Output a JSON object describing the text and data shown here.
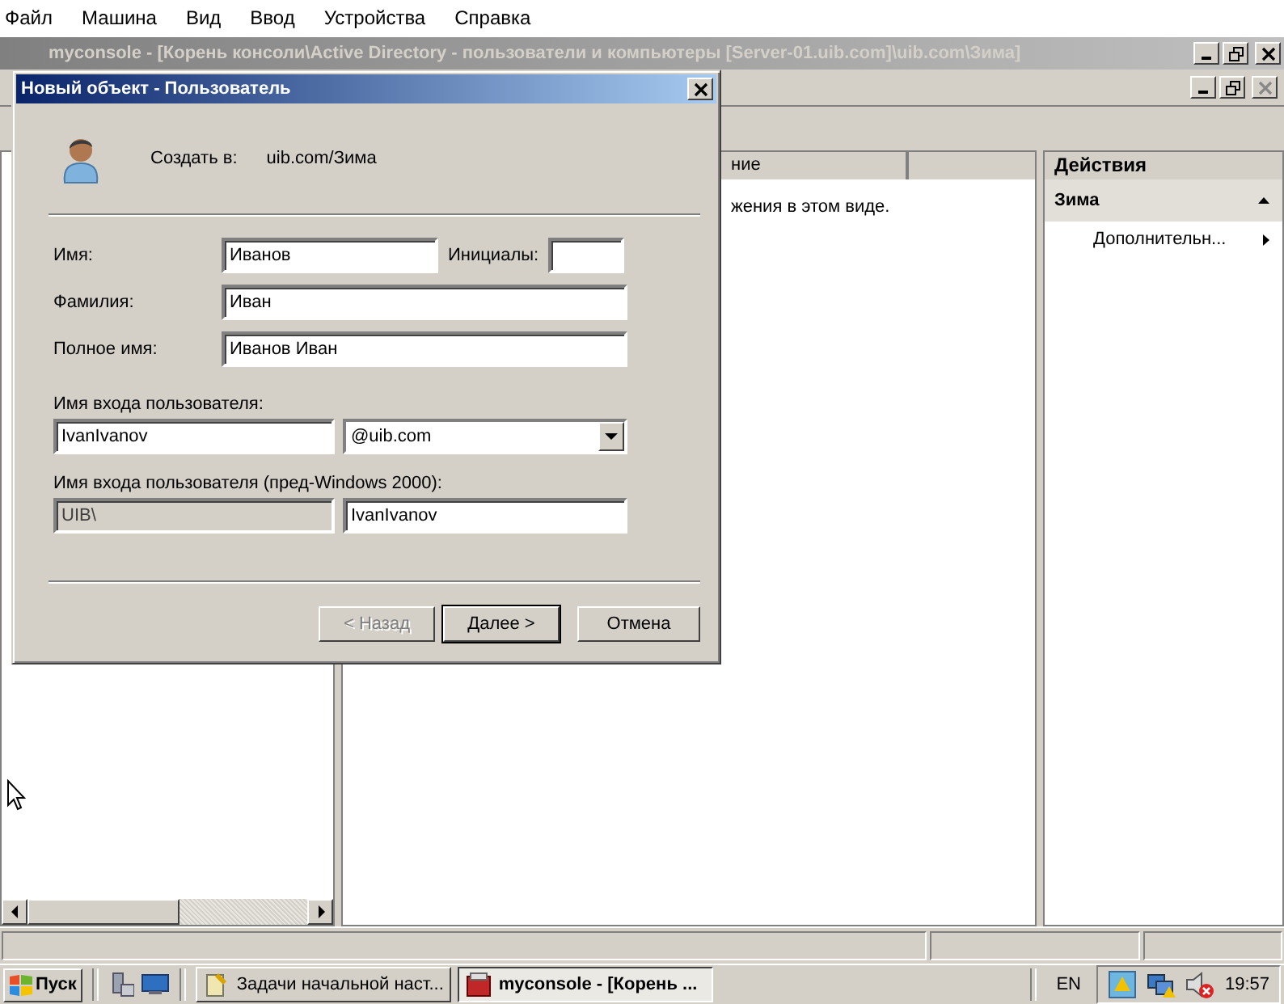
{
  "host_menu": [
    "Файл",
    "Машина",
    "Вид",
    "Ввод",
    "Устройства",
    "Справка"
  ],
  "window": {
    "title": "myconsole - [Корень консоли\\Active Directory - пользователи и компьютеры [Server-01.uib.com]\\uib.com\\Зима]"
  },
  "list_pane": {
    "column_1": "ние",
    "message": "жения в этом виде."
  },
  "actions_pane": {
    "title": "Действия",
    "section": "Зима",
    "items": [
      {
        "label": "Дополнительн..."
      }
    ]
  },
  "dialog": {
    "title": "Новый объект - Пользователь",
    "create_in_label": "Создать в:",
    "create_in_value": "uib.com/Зима",
    "first_name": {
      "label": "Имя:",
      "value": "Иванов"
    },
    "initials": {
      "label": "Инициалы:"
    },
    "last_name": {
      "label": "Фамилия:",
      "value": "Иван"
    },
    "full_name": {
      "label": "Полное имя:",
      "value": "Иванов Иван"
    },
    "logon": {
      "label": "Имя входа пользователя:",
      "value": "IvanIvanov",
      "suffix": "@uib.com"
    },
    "pre2000": {
      "label": "Имя входа пользователя (пред-Windows 2000):",
      "domain": "UIB\\",
      "value": "IvanIvanov",
      "domain_disabled": true
    },
    "buttons": [
      {
        "label": "< Назад",
        "disabled": true,
        "default": false
      },
      {
        "label": "Далее >",
        "disabled": false,
        "default": true
      },
      {
        "label": "Отмена",
        "disabled": false,
        "default": false
      }
    ]
  },
  "taskbar": {
    "start": "Пуск",
    "tasks": [
      {
        "label": "Задачи начальной наст...",
        "selected": false
      },
      {
        "label": "myconsole - [Корень ...",
        "selected": true
      }
    ],
    "language": "EN",
    "clock": "19:57"
  }
}
